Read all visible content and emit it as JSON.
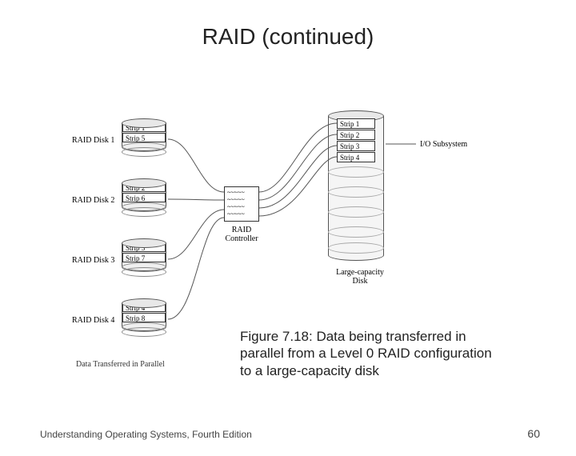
{
  "title": "RAID (continued)",
  "raid_disks": [
    {
      "label": "RAID Disk 1",
      "strips": [
        "Strip 1",
        "Strip 5"
      ]
    },
    {
      "label": "RAID Disk 2",
      "strips": [
        "Strip 2",
        "Strip 6"
      ]
    },
    {
      "label": "RAID Disk 3",
      "strips": [
        "Strip 3",
        "Strip 7"
      ]
    },
    {
      "label": "RAID Disk 4",
      "strips": [
        "Strip 4",
        "Strip 8"
      ]
    }
  ],
  "controller": {
    "label": "RAID Controller",
    "waves": "~~~~~\n~~~~~\n~~~~~\n~~~~~"
  },
  "large_disk": {
    "label": "Large-capacity Disk",
    "strips": [
      "Strip 1",
      "Strip 2",
      "Strip 3",
      "Strip 4"
    ]
  },
  "io_label": "I/O Subsystem",
  "bottom_note": "Data Transferred in Parallel",
  "caption": "Figure 7.18: Data being transferred in parallel from a Level 0 RAID configuration to a large-capacity disk",
  "footer_left": "Understanding Operating Systems, Fourth Edition",
  "footer_right": "60"
}
